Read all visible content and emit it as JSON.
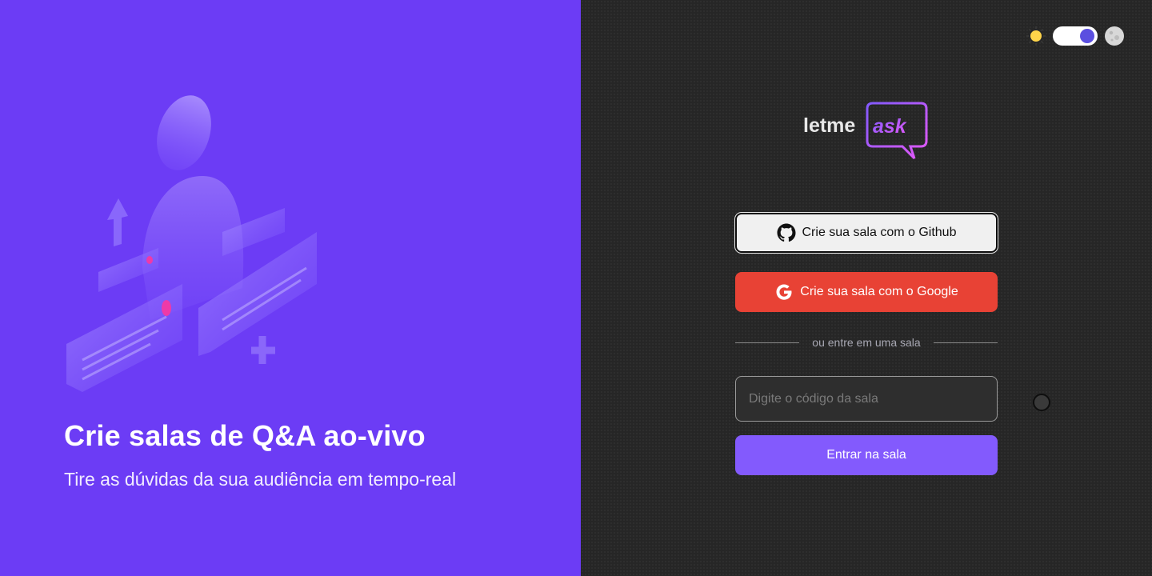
{
  "aside": {
    "title": "Crie salas de Q&A ao-vivo",
    "subtitle": "Tire as dúvidas da sua audiência em tempo-real",
    "illustration": "qa-illustration"
  },
  "theme": {
    "sun_icon": "sun-icon",
    "moon_icon": "moon-icon",
    "toggle_state": "dark"
  },
  "logo": {
    "part1": "letme",
    "part2": "ask"
  },
  "auth": {
    "github_label": "Crie sua sala com o Github",
    "github_icon": "github-icon",
    "google_label": "Crie sua sala com o Google",
    "google_icon": "google-icon"
  },
  "separator": {
    "text": "ou entre em uma sala"
  },
  "join": {
    "input_placeholder": "Digite o código da sala",
    "input_value": "",
    "button_label": "Entrar na sala"
  },
  "colors": {
    "aside_bg": "#6c3cf5",
    "main_bg": "#262626",
    "google": "#e84235",
    "primary": "#835afd"
  }
}
